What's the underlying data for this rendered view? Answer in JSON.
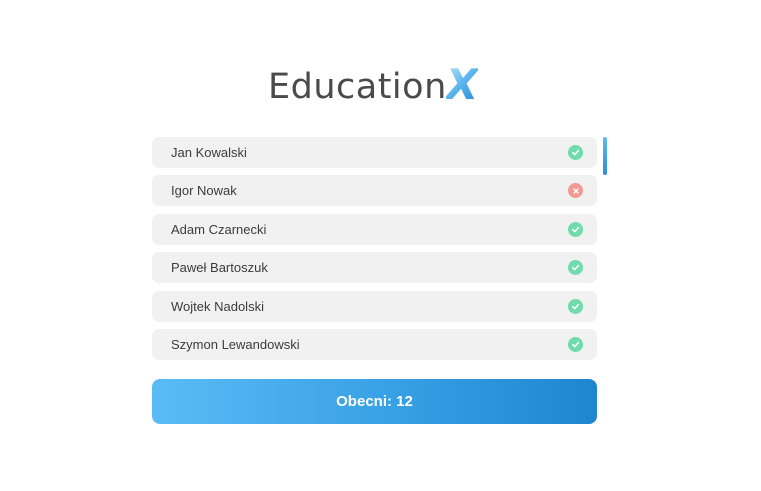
{
  "logo": {
    "text": "Education",
    "accent": "X"
  },
  "students": [
    {
      "name": "Jan Kowalski",
      "status": "present",
      "icon": "check-icon"
    },
    {
      "name": "Igor Nowak",
      "status": "absent",
      "icon": "x-icon"
    },
    {
      "name": "Adam Czarnecki",
      "status": "present",
      "icon": "check-icon"
    },
    {
      "name": "Paweł Bartoszuk",
      "status": "present",
      "icon": "check-icon"
    },
    {
      "name": "Wojtek Nadolski",
      "status": "present",
      "icon": "check-icon"
    },
    {
      "name": "Szymon Lewandowski",
      "status": "present",
      "icon": "check-icon"
    }
  ],
  "summary": {
    "label": "Obecni: 12"
  },
  "colors": {
    "present": "#6fdcab",
    "absent": "#f19a94",
    "accent_start": "#5bbcf5",
    "accent_end": "#1d86cf",
    "row_bg": "#f1f1f1"
  }
}
